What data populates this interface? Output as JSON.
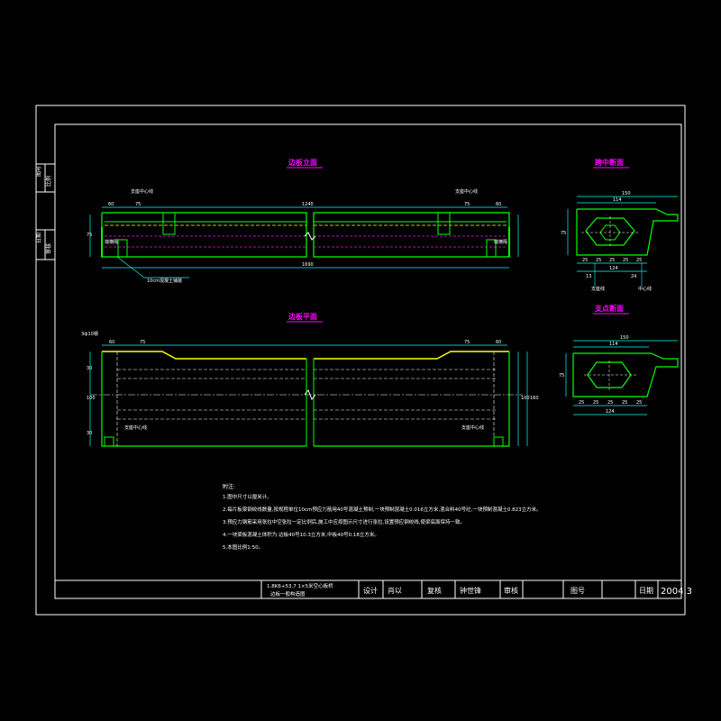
{
  "colors": {
    "frame": "#ffffff",
    "outline": "#00ff00",
    "centerline": "#ffffff",
    "hidden": "#ff00ff",
    "dim": "#00ffff",
    "title": "#ff00ff",
    "accent": "#ffff00"
  },
  "side_labels": {
    "top_a": "图号",
    "top_b": "比例",
    "bot_a": "日期",
    "bot_b": "审核"
  },
  "elevation": {
    "title": "边板立面",
    "dims_top": [
      "60",
      "75",
      "1240",
      "75",
      "60"
    ],
    "dim_total": "1690",
    "dim_height": "75",
    "label_left_center": "支座中心线",
    "label_right_center": "支座中心线",
    "label_left_end": "端横隔",
    "label_right_end": "端横隔",
    "label_leader": "10cm混凝土铺装"
  },
  "plan": {
    "title": "边板平面",
    "label_tl": "3ф10钢",
    "dims_top": [
      "60",
      "75",
      "75",
      "60"
    ],
    "dims_left": [
      "30",
      "100",
      "30"
    ],
    "dims_right": [
      "100",
      "160"
    ],
    "label_support_left": "支座中心线",
    "label_support_right": "支座中心线"
  },
  "mid_section": {
    "title": "跨中断面",
    "dim_top": "150",
    "dim_inner": "114",
    "dims_bottom": [
      "25",
      "25",
      "25",
      "25",
      "25"
    ],
    "dim_bottom_total": "124",
    "dim_bottom_b": "13",
    "dim_bottom_c": "24",
    "dim_left": "75",
    "label_a": "支座线",
    "label_b": "中心线"
  },
  "support_section": {
    "title": "支点断面",
    "dim_top": "150",
    "dim_inner": "114",
    "dims_bottom": [
      "25",
      "25",
      "25",
      "25",
      "25"
    ],
    "dim_bottom_total": "124",
    "dim_left": "75"
  },
  "notes": {
    "heading": "附注:",
    "lines": [
      "1.图中尺寸以厘米计。",
      "2.每片板梁钢绞线数量,按规程单位10cm预应力筋用40号混凝土预制,一块预制混凝土0.016立方米,混合料40号砼,一块预制混凝土0.823立方米。",
      "3.预应力钢筋采用张拉中空张拉一定比例后,施工中应按图示尺寸进行张拉,设置预应钢绞线,使梁底面保持一致。",
      "4.一块梁板混凝土体积为:边板40号10.3立方米,中板40号0.18立方米。",
      "5.本图比例1:50。"
    ]
  },
  "title_block": {
    "project": "1.8K6+53.7 1×5米空心板桥",
    "drawing": "边板一般构造图",
    "design_label": "设计",
    "design_sig": "肖以",
    "review_label": "复核",
    "review_sig": "钟世锋",
    "approve_label": "审核",
    "approve_sig": "",
    "dwg_no_label": "图号",
    "dwg_no": "",
    "date_label": "日期",
    "date": "2004.3"
  }
}
